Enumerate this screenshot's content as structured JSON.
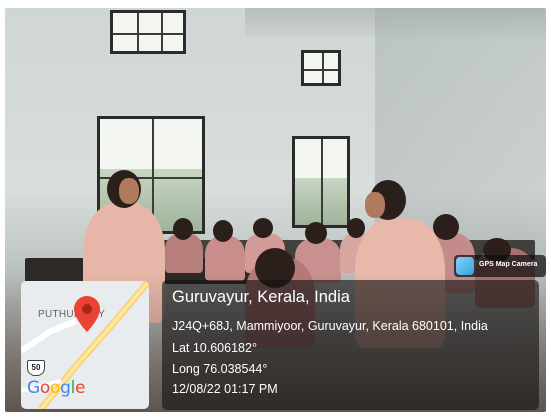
{
  "map": {
    "place_label": "PUTHUPALLY",
    "road_shield": "50",
    "logo_text": "Google"
  },
  "stamp": {
    "title": "Guruvayur, Kerala, India",
    "address": "J24Q+68J, Mammiyoor, Guruvayur, Kerala 680101, India",
    "latitude": "Lat 10.606182°",
    "longitude": "Long 76.038544°",
    "datetime": "12/08/22 01:17 PM"
  },
  "badge": {
    "app_name": "GPS Map Camera"
  }
}
